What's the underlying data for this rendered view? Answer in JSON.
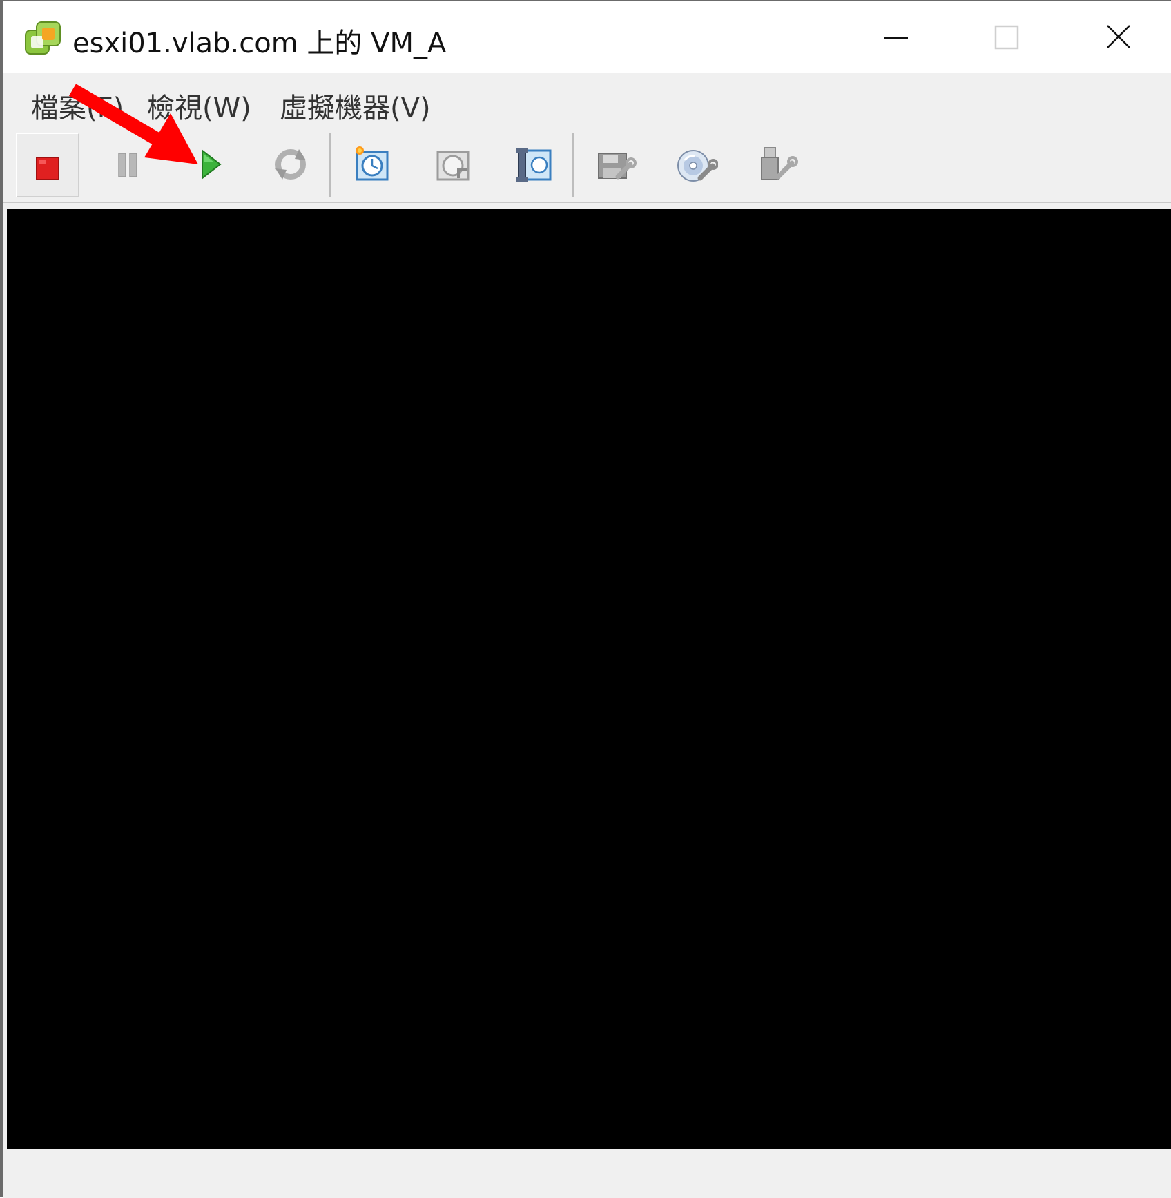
{
  "window": {
    "title": "esxi01.vlab.com 上的 VM_A",
    "app_icon": "vsphere-icon",
    "controls": {
      "minimize": "minimize-icon",
      "maximize": "maximize-icon",
      "close": "close-icon"
    }
  },
  "menubar": {
    "items": [
      {
        "label": "檔案(F)"
      },
      {
        "label": "檢視(W)"
      },
      {
        "label": "虛擬機器(V)"
      }
    ]
  },
  "toolbar": {
    "buttons": [
      {
        "icon": "power-off-icon",
        "state": "pressed"
      },
      {
        "icon": "suspend-icon",
        "state": "disabled"
      },
      {
        "icon": "power-on-icon",
        "state": "enabled"
      },
      {
        "icon": "reset-icon",
        "state": "disabled"
      },
      {
        "icon": "take-snapshot-icon",
        "state": "enabled"
      },
      {
        "icon": "revert-snapshot-icon",
        "state": "disabled"
      },
      {
        "icon": "snapshot-manager-icon",
        "state": "enabled"
      },
      {
        "icon": "floppy-device-icon",
        "state": "disabled"
      },
      {
        "icon": "cd-dvd-device-icon",
        "state": "enabled"
      },
      {
        "icon": "usb-device-icon",
        "state": "disabled"
      }
    ]
  },
  "colors": {
    "stop_red": "#e02020",
    "play_green": "#3cb33c",
    "annotation_red": "#ff0000",
    "console_bg": "#000000"
  }
}
